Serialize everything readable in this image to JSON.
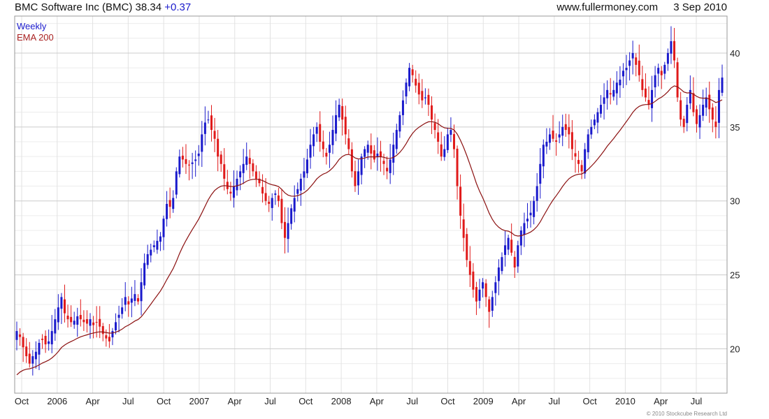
{
  "header": {
    "title": "BMC Software Inc (BMC) 38.34",
    "change": "+0.37",
    "site": "www.fullermoney.com",
    "date": "3 Sep 2010"
  },
  "legend": {
    "weekly": "Weekly",
    "ema": "EMA 200"
  },
  "copyright": "© 2010 Stockcube Research Ltd",
  "colors": {
    "up": "#1a1acc",
    "down": "#e01a1a",
    "ema": "#8b1010",
    "grid": "#cccccc"
  },
  "chart_data": {
    "type": "candlestick",
    "ylim": [
      17,
      42.5
    ],
    "y_ticks": [
      20,
      25,
      30,
      35,
      40
    ],
    "x_ticks": [
      "Oct",
      "2006",
      "Apr",
      "Jul",
      "Oct",
      "2007",
      "Apr",
      "Jul",
      "Oct",
      "2008",
      "Apr",
      "Jul",
      "Oct",
      "2009",
      "Apr",
      "Jul",
      "Oct",
      "2010",
      "Apr",
      "Jul"
    ],
    "series": [
      {
        "name": "Weekly",
        "type": "candlestick",
        "values_note": "weekly closes, approximate",
        "close": [
          21.2,
          20.8,
          20.1,
          19.5,
          19.0,
          19.5,
          19.8,
          20.4,
          20.6,
          20.3,
          20.5,
          21.2,
          22.0,
          22.8,
          23.5,
          22.4,
          22.0,
          21.8,
          21.9,
          22.2,
          22.0,
          21.8,
          21.7,
          22.0,
          21.6,
          21.8,
          21.5,
          21.0,
          20.7,
          20.5,
          21.2,
          21.8,
          22.3,
          22.8,
          23.5,
          23.0,
          23.4,
          23.7,
          23.2,
          24.5,
          25.8,
          26.4,
          26.7,
          27.0,
          27.3,
          27.6,
          28.8,
          29.8,
          29.6,
          30.2,
          32.0,
          33.0,
          32.8,
          32.5,
          32.4,
          32.6,
          32.8,
          33.2,
          34.5,
          35.3,
          35.5,
          34.8,
          34.2,
          33.0,
          32.5,
          31.5,
          30.8,
          30.5,
          31.0,
          31.5,
          32.0,
          32.5,
          33.0,
          32.5,
          32.0,
          31.5,
          31.2,
          30.5,
          30.0,
          29.8,
          30.2,
          30.5,
          30.0,
          28.5,
          27.5,
          28.5,
          29.5,
          30.2,
          30.8,
          31.5,
          32.0,
          32.8,
          33.8,
          34.5,
          35.0,
          34.0,
          33.5,
          33.0,
          33.8,
          34.8,
          35.8,
          36.5,
          35.5,
          34.5,
          33.5,
          32.0,
          31.0,
          32.0,
          33.0,
          33.5,
          33.8,
          33.2,
          32.8,
          33.2,
          33.0,
          32.5,
          32.0,
          32.8,
          33.8,
          34.8,
          35.8,
          36.8,
          38.0,
          39.0,
          38.5,
          37.8,
          37.2,
          36.8,
          37.0,
          36.5,
          35.5,
          34.8,
          34.0,
          33.0,
          33.5,
          34.5,
          34.8,
          33.5,
          31.0,
          29.0,
          27.5,
          26.0,
          25.0,
          24.0,
          23.2,
          24.0,
          24.5,
          23.5,
          22.5,
          23.5,
          24.5,
          25.5,
          26.2,
          27.0,
          27.5,
          26.5,
          25.5,
          27.0,
          28.0,
          28.5,
          28.8,
          29.2,
          30.0,
          31.0,
          32.5,
          33.8,
          34.0,
          34.5,
          34.2,
          34.0,
          34.5,
          35.0,
          34.8,
          34.5,
          33.5,
          33.0,
          32.5,
          32.0,
          33.5,
          34.5,
          35.0,
          35.5,
          36.0,
          36.5,
          37.0,
          37.5,
          37.2,
          37.5,
          38.0,
          38.2,
          38.8,
          39.0,
          39.5,
          40.0,
          39.2,
          38.5,
          37.5,
          37.0,
          36.5,
          37.5,
          38.5,
          39.0,
          38.5,
          39.2,
          40.0,
          40.8,
          39.5,
          37.0,
          35.5,
          35.0,
          36.5,
          37.5,
          36.0,
          35.2,
          35.8,
          36.5,
          37.0,
          36.2,
          35.5,
          35.0,
          37.5,
          38.34
        ]
      },
      {
        "name": "EMA 200",
        "type": "line"
      }
    ]
  }
}
